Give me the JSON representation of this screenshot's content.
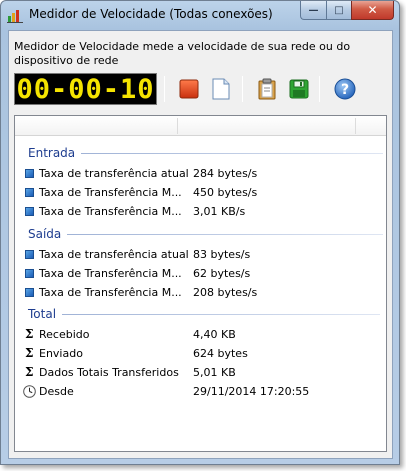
{
  "window": {
    "title": "Medidor de Velocidade (Todas conexões)",
    "description": "Medidor de Velocidade mede a velocidade de sua rede ou do dispositivo de rede"
  },
  "toolbar": {
    "timer": "00-00-10",
    "buttons": [
      {
        "name": "stop",
        "icon": "stop-icon",
        "color": "#e0491b"
      },
      {
        "name": "new",
        "icon": "document-icon"
      },
      {
        "name": "clipboard",
        "icon": "clipboard-icon"
      },
      {
        "name": "save",
        "icon": "save-icon",
        "color": "#2fa533"
      },
      {
        "name": "help",
        "icon": "help-icon",
        "color": "#3b7fd6"
      }
    ]
  },
  "groups": {
    "entrada": {
      "title": "Entrada",
      "rows": [
        {
          "label": "Taxa de transferência atual",
          "value": "284 bytes/s"
        },
        {
          "label": "Taxa de Transferência M...",
          "value": "450 bytes/s"
        },
        {
          "label": "Taxa de Transferência M...",
          "value": "3,01 KB/s"
        }
      ]
    },
    "saida": {
      "title": "Saída",
      "rows": [
        {
          "label": "Taxa de transferência atual",
          "value": "83 bytes/s"
        },
        {
          "label": "Taxa de Transferência M...",
          "value": "62 bytes/s"
        },
        {
          "label": "Taxa de Transferência M...",
          "value": "208 bytes/s"
        }
      ]
    },
    "total": {
      "title": "Total",
      "rows": [
        {
          "label": "Recebido",
          "value": "4,40 KB",
          "icon": "sigma-icon"
        },
        {
          "label": "Enviado",
          "value": "624 bytes",
          "icon": "sigma-icon"
        },
        {
          "label": "Dados Totais Transferidos",
          "value": "5,01 KB",
          "icon": "sigma-icon"
        },
        {
          "label": "Desde",
          "value": "29/11/2014 17:20:55",
          "icon": "clock-icon"
        }
      ]
    }
  },
  "colors": {
    "group_header": "#1e3d8f",
    "timer_digits": "#f5e400"
  }
}
